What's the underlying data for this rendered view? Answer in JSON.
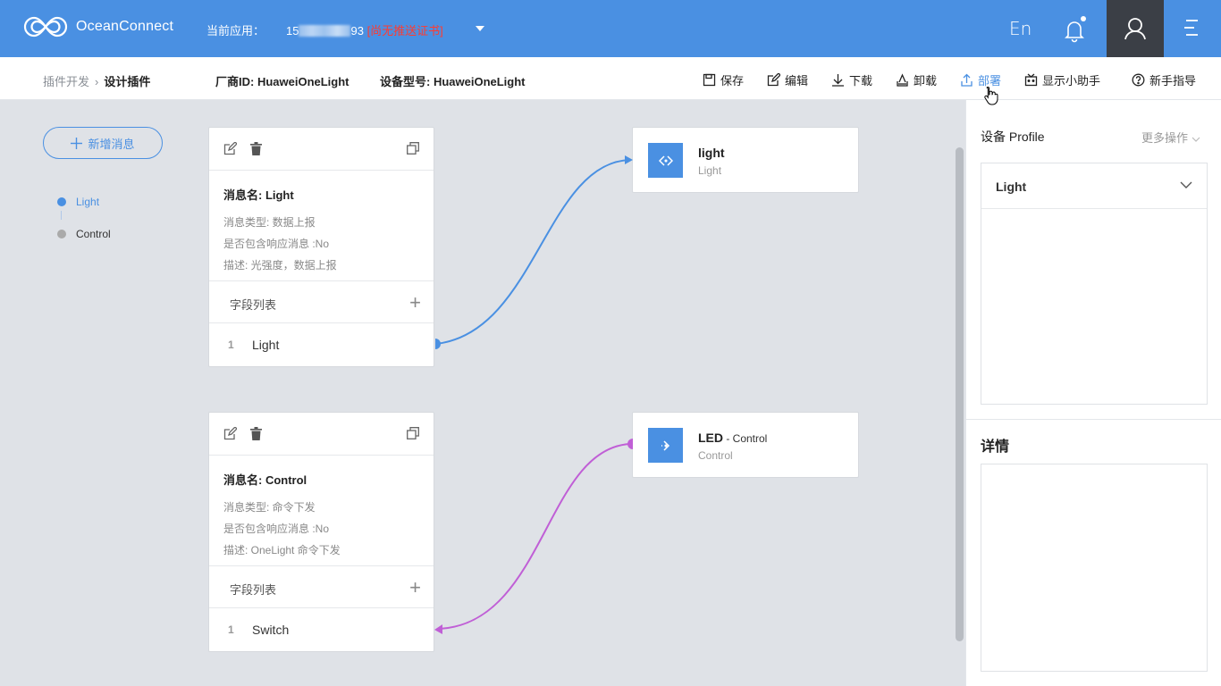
{
  "header": {
    "brand": "OceanConnect",
    "current_app_label": "当前应用：",
    "app_id_prefix": "15",
    "app_id_suffix": "93",
    "cert_status": "[尚无推送证书]",
    "lang": "En"
  },
  "subbar": {
    "breadcrumb_parent": "插件开发",
    "breadcrumb_current": "设计插件",
    "vendor": "厂商ID: HuaweiOneLight",
    "model": "设备型号: HuaweiOneLight",
    "actions": {
      "save": "保存",
      "edit": "编辑",
      "download": "下载",
      "uninstall": "卸载",
      "deploy": "部署",
      "helper": "显示小助手",
      "guide": "新手指导"
    }
  },
  "left_nav": {
    "add_button": "新增消息",
    "items": [
      {
        "label": "Light",
        "color": "#4a90e2"
      },
      {
        "label": "Control",
        "color": "#aaaaaa"
      }
    ]
  },
  "messages": [
    {
      "title": "消息名: Light",
      "type": "消息类型: 数据上报",
      "has_response": "是否包含响应消息 :No",
      "desc": "描述: 光强度，数据上报",
      "field_list_label": "字段列表",
      "fields": [
        {
          "index": "1",
          "name": "Light"
        }
      ]
    },
    {
      "title": "消息名: Control",
      "type": "消息类型: 命令下发",
      "has_response": "是否包含响应消息 :No",
      "desc": "描述: OneLight 命令下发",
      "field_list_label": "字段列表",
      "fields": [
        {
          "index": "1",
          "name": "Switch"
        }
      ]
    }
  ],
  "targets": [
    {
      "name": "light",
      "sub": "",
      "desc": "Light"
    },
    {
      "name": "LED",
      "sub": " - Control",
      "desc": "Control"
    }
  ],
  "right_panel": {
    "title": "设备 Profile",
    "more": "更多操作",
    "profile_selected": "Light",
    "detail_title": "详情"
  },
  "colors": {
    "accent": "#4a90e2",
    "link_data": "#4a90e2",
    "link_command": "#c05fd6",
    "cert_warning": "#ff3b30"
  }
}
